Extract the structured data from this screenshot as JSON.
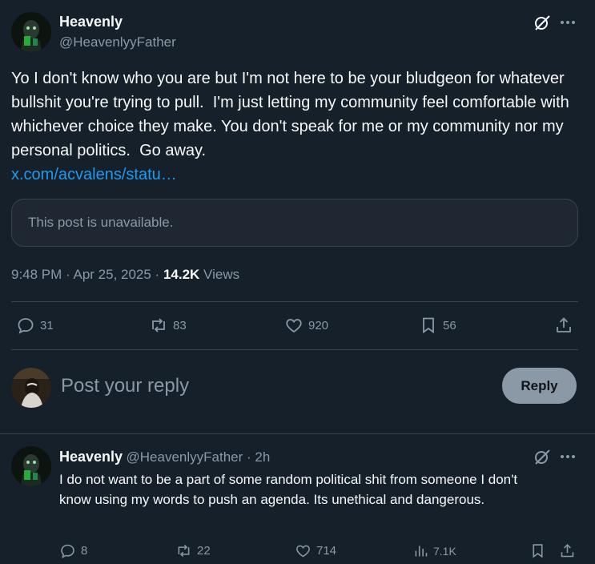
{
  "main_post": {
    "author_name": "Heavenly",
    "author_handle": "@HeavenlyyFather",
    "body": "Yo I don't know who you are but I'm not here to be your bludgeon for whatever bullshit you're trying to pull.  I'm just letting my community feel comfortable with whichever choice they make. You don't speak for me or my community nor my personal politics.  Go away.",
    "link": "x.com/acvalens/statu…",
    "quoted_unavailable": "This post is unavailable.",
    "timestamp": "9:48 PM · Apr 25, 2025 · ",
    "views_count": "14.2K",
    "views_label": " Views",
    "actions": {
      "replies": "31",
      "reposts": "83",
      "likes": "920",
      "bookmarks": "56"
    }
  },
  "composer": {
    "placeholder": "Post your reply",
    "reply_label": "Reply"
  },
  "reply_post": {
    "author_name": "Heavenly",
    "author_handle": "@HeavenlyyFather",
    "age": " · 2h",
    "body": "I do not want to be a part of some random political shit from someone I don't know using my words to push an agenda.  Its unethical and dangerous.",
    "actions": {
      "replies": "8",
      "reposts": "22",
      "likes": "714",
      "views": "7.1K"
    }
  },
  "icons": [
    "grok-icon",
    "more-icon",
    "reply-icon",
    "repost-icon",
    "like-icon",
    "bookmark-icon",
    "share-icon",
    "views-icon"
  ],
  "colors": {
    "background": "#15202b",
    "link": "#1d9bf0",
    "muted": "#8b98a5",
    "border": "#38444d"
  }
}
